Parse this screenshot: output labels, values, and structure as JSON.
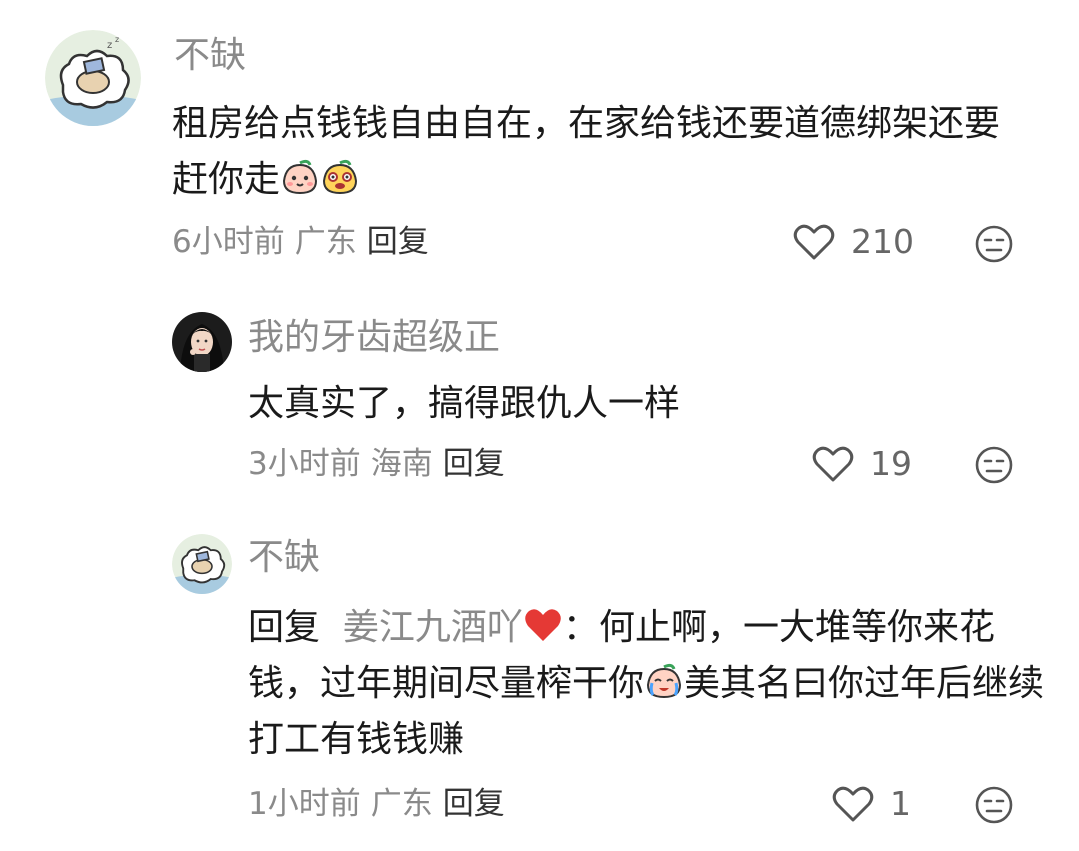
{
  "comments": [
    {
      "username": "不缺",
      "text": "租房给点钱钱自由自在，在家给钱还要道德绑架还要赶你走",
      "meta": {
        "time": "6小时前",
        "location": "广东",
        "reply": "回复"
      },
      "likes": "210",
      "avatar_icon": "sleeping-sheep-avatar"
    },
    {
      "username": "我的牙齿超级正",
      "text": "太真实了，搞得跟仇人一样",
      "meta": {
        "time": "3小时前",
        "location": "海南",
        "reply": "回复"
      },
      "likes": "19",
      "avatar_icon": "girl-photo-avatar"
    },
    {
      "username": "不缺",
      "reply_prefix": "回复",
      "reply_to": "姜江九酒吖",
      "colon": "：",
      "text_part1": "何止啊，一大堆等你来花钱，过年期间尽量榨干你",
      "text_part2": "美其名曰你过年后继续打工有钱钱赚",
      "meta": {
        "time": "1小时前",
        "location": "广东",
        "reply": "回复"
      },
      "likes": "1",
      "avatar_icon": "sleeping-sheep-avatar"
    }
  ],
  "colors": {
    "muted": "#8a8a8a",
    "text": "#1a1a1a",
    "heart": "#e53935"
  }
}
